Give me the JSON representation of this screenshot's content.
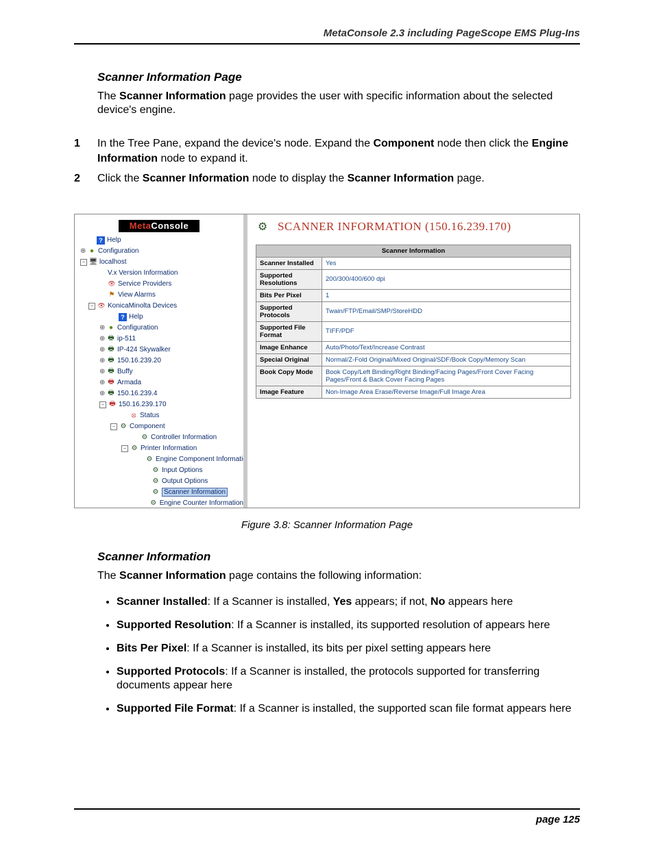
{
  "header": {
    "running": "MetaConsole 2.3 including PageScope EMS Plug-Ins"
  },
  "footer": {
    "page": "page 125"
  },
  "section1": {
    "title": "Scanner Information Page",
    "intro_pre": "The ",
    "intro_bold": "Scanner Information",
    "intro_post": " page provides the user with specific information about the selected device's engine."
  },
  "steps": [
    {
      "num": "1",
      "pre": "In the Tree Pane, expand the device's node. Expand the ",
      "b1": "Component",
      "mid": " node then click the ",
      "b2": "Engine Information",
      "post": " node to expand it."
    },
    {
      "num": "2",
      "pre": "Click the ",
      "b1": "Scanner Information",
      "mid": " node to display the ",
      "b2": "Scanner Information",
      "post": " page."
    }
  ],
  "figure": {
    "caption": "Figure 3.8:  Scanner Information Page",
    "logo": {
      "meta": "Meta",
      "console": "Console"
    },
    "tree": [
      {
        "indent": 1,
        "toggle": "",
        "icon": "i-help",
        "glyph": "?",
        "label": "Help",
        "interact": true
      },
      {
        "indent": 0,
        "toggle": "o",
        "icon": "i-cfg",
        "glyph": "●",
        "label": "Configuration",
        "interact": true
      },
      {
        "indent": 0,
        "toggle": "-",
        "icon": "i-host",
        "glyph": "🖥",
        "label": "localhost",
        "interact": true
      },
      {
        "indent": 2,
        "toggle": "",
        "icon": "",
        "glyph": "",
        "label": "V.x Version Information",
        "interact": true
      },
      {
        "indent": 2,
        "toggle": "",
        "icon": "i-eye",
        "glyph": "👁",
        "label": "Service Providers",
        "interact": true
      },
      {
        "indent": 2,
        "toggle": "",
        "icon": "i-alarm",
        "glyph": "⚑",
        "label": "View Alarms",
        "interact": true
      },
      {
        "indent": 1,
        "toggle": "-",
        "icon": "i-eye",
        "glyph": "👁",
        "label": "KonicaMinolta Devices",
        "interact": true
      },
      {
        "indent": 3,
        "toggle": "",
        "icon": "i-help",
        "glyph": "?",
        "label": "Help",
        "interact": true
      },
      {
        "indent": 2,
        "toggle": "o",
        "icon": "i-cfg",
        "glyph": "●",
        "label": "Configuration",
        "interact": true
      },
      {
        "indent": 2,
        "toggle": "o",
        "icon": "i-dev",
        "glyph": "🖶",
        "label": "ip-511",
        "interact": true
      },
      {
        "indent": 2,
        "toggle": "o",
        "icon": "i-dev",
        "glyph": "🖶",
        "label": "IP-424 Skywalker",
        "interact": true
      },
      {
        "indent": 2,
        "toggle": "o",
        "icon": "i-dev",
        "glyph": "🖶",
        "label": "150.16.239.20",
        "interact": true
      },
      {
        "indent": 2,
        "toggle": "o",
        "icon": "i-dev",
        "glyph": "🖶",
        "label": "Buffy",
        "interact": true
      },
      {
        "indent": 2,
        "toggle": "o",
        "icon": "i-red",
        "glyph": "🖶",
        "label": "Armada",
        "interact": true
      },
      {
        "indent": 2,
        "toggle": "o",
        "icon": "i-dev",
        "glyph": "🖶",
        "label": "150.16.239.4",
        "interact": true
      },
      {
        "indent": 2,
        "toggle": "-",
        "icon": "i-red",
        "glyph": "🖶",
        "label": "150.16.239.170",
        "interact": true
      },
      {
        "indent": 4,
        "toggle": "",
        "icon": "i-status",
        "glyph": "⦻",
        "label": "Status",
        "interact": true
      },
      {
        "indent": 3,
        "toggle": "-",
        "icon": "i-comp",
        "glyph": "⚙",
        "label": "Component",
        "interact": true
      },
      {
        "indent": 5,
        "toggle": "",
        "icon": "i-comp",
        "glyph": "⚙",
        "label": "Controller Information",
        "interact": true
      },
      {
        "indent": 4,
        "toggle": "-",
        "icon": "i-comp",
        "glyph": "⚙",
        "label": "Printer Information",
        "interact": true
      },
      {
        "indent": 6,
        "toggle": "",
        "icon": "i-comp",
        "glyph": "⚙",
        "label": "Engine Component Information",
        "interact": true
      },
      {
        "indent": 6,
        "toggle": "",
        "icon": "i-comp",
        "glyph": "⚙",
        "label": "Input Options",
        "interact": true
      },
      {
        "indent": 6,
        "toggle": "",
        "icon": "i-comp",
        "glyph": "⚙",
        "label": "Output Options",
        "interact": true
      },
      {
        "indent": 6,
        "toggle": "",
        "icon": "i-comp",
        "glyph": "⚙",
        "label": "Scanner Information",
        "selected": true,
        "interact": true
      },
      {
        "indent": 6,
        "toggle": "",
        "icon": "i-comp",
        "glyph": "⚙",
        "label": "Engine Counter Information",
        "interact": true
      }
    ],
    "panel": {
      "title": "SCANNER INFORMATION (150.16.239.170)",
      "table_header": "Scanner Information",
      "rows": [
        {
          "k": "Scanner Installed",
          "v": "Yes"
        },
        {
          "k": "Supported Resolutions",
          "v": "200/300/400/600 dpi"
        },
        {
          "k": "Bits Per Pixel",
          "v": "1"
        },
        {
          "k": "Supported Protocols",
          "v": "Twain/FTP/Email/SMP/StoreHDD"
        },
        {
          "k": "Supported File Format",
          "v": "TIFF/PDF"
        },
        {
          "k": "Image Enhance",
          "v": "Auto/Photo/Text/Increase Contrast"
        },
        {
          "k": "Special Original",
          "v": "Normal/Z-Fold Original/Mixed Original/SDF/Book Copy/Memory Scan"
        },
        {
          "k": "Book Copy Mode",
          "v": "Book Copy/Left Binding/Right Binding/Facing Pages/Front Cover Facing Pages/Front & Back Cover Facing Pages"
        },
        {
          "k": "Image Feature",
          "v": "Non-Image Area Erase/Reverse Image/Full Image Area"
        }
      ]
    }
  },
  "section2": {
    "title": "Scanner Information",
    "intro_pre": "The ",
    "intro_bold": "Scanner Information",
    "intro_post": " page contains the following information:",
    "bullets": [
      {
        "b": "Scanner Installed",
        "post": ": If a Scanner is installed, ",
        "b2": "Yes",
        "mid": " appears; if not, ",
        "b3": "No",
        "tail": " appears here"
      },
      {
        "b": "Supported Resolution",
        "post": ": If a Scanner is installed, its supported resolution of appears here"
      },
      {
        "b": "Bits Per Pixel",
        "post": ": If a Scanner is installed, its bits per pixel setting appears here"
      },
      {
        "b": "Supported Protocols",
        "post": ": If a Scanner is installed, the protocols supported for transferring documents appear here"
      },
      {
        "b": "Supported File Format",
        "post": ": If a Scanner is installed, the supported scan file format appears here"
      }
    ]
  }
}
